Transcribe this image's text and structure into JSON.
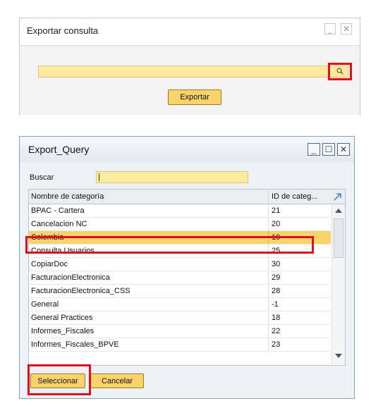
{
  "export_dialog": {
    "title": "Exportar consulta",
    "minimize_icon": "minimize-icon",
    "close_icon": "close-icon",
    "search_field_value": "",
    "search_icon": "magnifier-icon",
    "export_button": "Exportar"
  },
  "query_window": {
    "title": "Export_Query",
    "buscar_label": "Buscar",
    "buscar_value": "",
    "columns": {
      "name": "Nombre de categoría",
      "id": "ID de categ..."
    },
    "rows": [
      {
        "name": "BPAC - Cartera",
        "id": "21"
      },
      {
        "name": "Cancelacion NC",
        "id": "20"
      },
      {
        "name": "Colombia",
        "id": "19"
      },
      {
        "name": "Consulta Usuarios",
        "id": "25"
      },
      {
        "name": "CopiarDoc",
        "id": "30"
      },
      {
        "name": "FacturacionElectronica",
        "id": "29"
      },
      {
        "name": "FacturacionElectronica_CSS",
        "id": "28"
      },
      {
        "name": "General",
        "id": "-1"
      },
      {
        "name": "General Practices",
        "id": "18"
      },
      {
        "name": "Informes_Fiscales",
        "id": "22"
      },
      {
        "name": "Informes_Fiscales_BPVE",
        "id": "23"
      }
    ],
    "selected_row": "Colombia",
    "select_button": "Seleccionar",
    "cancel_button": "Cancelar"
  },
  "colors": {
    "field_yellow": "#fbeaa0",
    "button_yellow": "#f7d36a",
    "selected_row": "#f9d36b",
    "highlight_red": "#e0101b"
  }
}
